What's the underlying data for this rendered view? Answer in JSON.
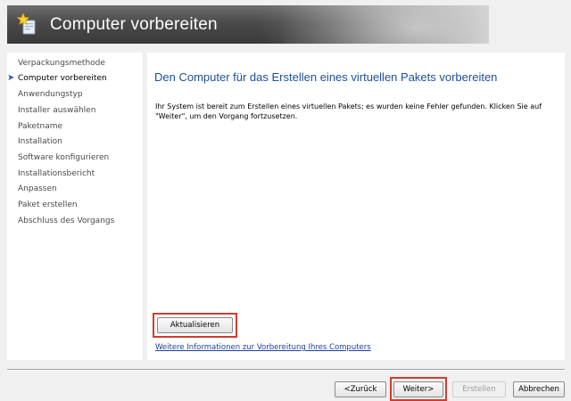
{
  "header": {
    "title": "Computer vorbereiten",
    "icon": "wizard-star-icon"
  },
  "sidebar": {
    "current_indicator_icon": "arrow-right-icon",
    "items": [
      {
        "label": "Verpackungsmethode",
        "current": false
      },
      {
        "label": "Computer vorbereiten",
        "current": true
      },
      {
        "label": "Anwendungstyp",
        "current": false
      },
      {
        "label": "Installer auswählen",
        "current": false
      },
      {
        "label": "Paketname",
        "current": false
      },
      {
        "label": "Installation",
        "current": false
      },
      {
        "label": "Software konfigurieren",
        "current": false
      },
      {
        "label": "Installationsbericht",
        "current": false
      },
      {
        "label": "Anpassen",
        "current": false
      },
      {
        "label": "Paket erstellen",
        "current": false
      },
      {
        "label": "Abschluss des Vorgangs",
        "current": false
      }
    ]
  },
  "main": {
    "heading": "Den Computer für das Erstellen eines virtuellen Pakets vorbereiten",
    "description": "Ihr System ist bereit zum Erstellen eines virtuellen Pakets; es wurden keine Fehler gefunden. Klicken Sie auf \"Weiter\", um den Vorgang fortzusetzen.",
    "refresh_label": "Aktualisieren",
    "info_link": "Weitere Informationen zur Vorbereitung Ihres Computers"
  },
  "footer": {
    "back_label": "<Zurück",
    "next_label": "Weiter>",
    "create_label": "Erstellen",
    "cancel_label": "Abbrechen"
  },
  "colors": {
    "heading": "#1b4f9c",
    "link": "#1e3f9e",
    "highlight": "#d23b2e"
  }
}
